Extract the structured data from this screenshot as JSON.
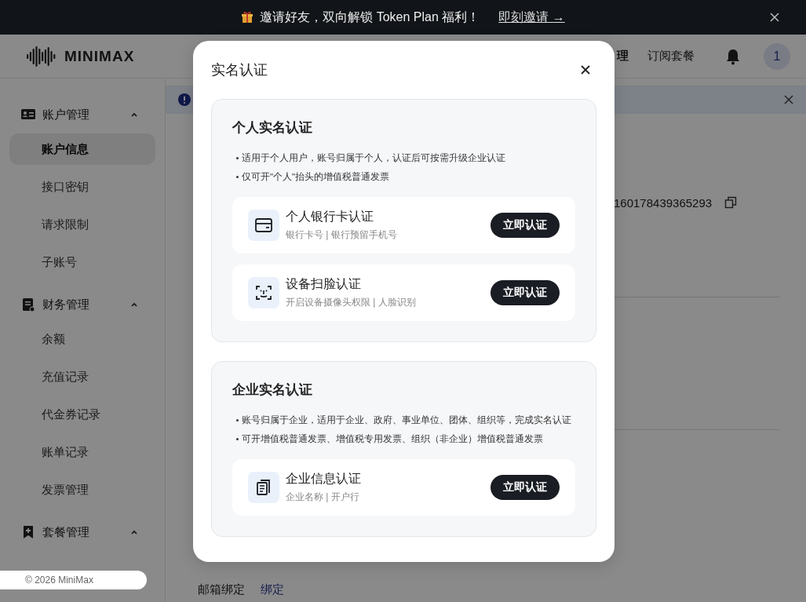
{
  "banner": {
    "text": "邀请好友，双向解锁 Token Plan 福利！",
    "link": "即刻邀请 →"
  },
  "header": {
    "logo": "MINIMAX",
    "nav": [
      "理",
      "订阅套餐"
    ],
    "avatar": "1"
  },
  "sidebar": {
    "groups": [
      {
        "label": "账户管理",
        "expanded": true,
        "items": [
          {
            "label": "账户信息",
            "selected": true
          },
          {
            "label": "接口密钥",
            "selected": false
          },
          {
            "label": "请求限制",
            "selected": false
          },
          {
            "label": "子账号",
            "selected": false
          }
        ]
      },
      {
        "label": "财务管理",
        "expanded": true,
        "items": [
          {
            "label": "余额",
            "selected": false
          },
          {
            "label": "充值记录",
            "selected": false
          },
          {
            "label": "代金券记录",
            "selected": false
          },
          {
            "label": "账单记录",
            "selected": false
          },
          {
            "label": "发票管理",
            "selected": false
          }
        ]
      },
      {
        "label": "套餐管理",
        "expanded": true
      }
    ],
    "footer": "© 2026 MiniMax"
  },
  "main": {
    "account_id": "160178439365293",
    "email_label": "邮箱绑定",
    "email_action": "绑定"
  },
  "dialog": {
    "title": "实名认证",
    "sections": [
      {
        "title": "个人实名认证",
        "notes": [
          "适用于个人用户，账号归属于个人，认证后可按需升级企业认证",
          "仅可开\"个人\"抬头的增值税普通发票"
        ],
        "options": [
          {
            "title": "个人银行卡认证",
            "subtitle": "银行卡号 | 银行预留手机号",
            "button": "立即认证"
          },
          {
            "title": "设备扫脸认证",
            "subtitle": "开启设备摄像头权限 | 人脸识别",
            "button": "立即认证"
          }
        ]
      },
      {
        "title": "企业实名认证",
        "notes": [
          "账号归属于企业，适用于企业、政府、事业单位、团体、组织等，完成实名认证",
          "可开增值税普通发票、增值税专用发票、组织（非企业）增值税普通发票"
        ],
        "options": [
          {
            "title": "企业信息认证",
            "subtitle": "企业名称 | 开户行",
            "button": "立即认证"
          }
        ]
      }
    ]
  }
}
